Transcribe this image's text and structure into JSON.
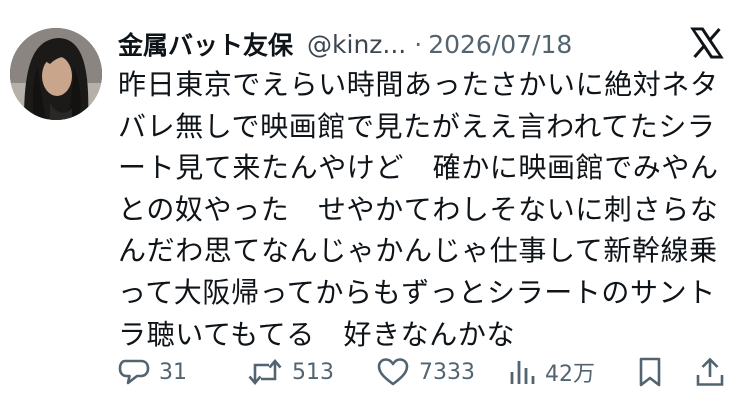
{
  "tweet": {
    "display_name": "金属バット友保",
    "handle": "@kinz...",
    "separator": "·",
    "date": "2026/07/18",
    "text_lines": [
      "昨日東京でえらい時間あったさかいに絶対ネタ",
      "バレ無しで映画館で見たがええ言われてたシラ",
      "ート見て来たんやけど　確かに映画館でみやん",
      "との奴やった　せやかてわしそないに刺さらな",
      "んだわ思てなんじゃかんじゃ仕事して新幹線乗",
      "って大阪帰ってからもずっとシラートのサント",
      "ラ聴いてもてる　好きなんかな"
    ]
  },
  "actions": {
    "replies": "31",
    "reposts": "513",
    "likes": "7333",
    "views": "42万"
  },
  "icons": {
    "brand": "x-logo-icon",
    "reply": "speech-bubble-icon",
    "repost": "repost-arrows-icon",
    "like": "heart-icon",
    "views": "bar-chart-icon",
    "bookmark": "bookmark-icon",
    "share": "share-upload-icon"
  },
  "colors": {
    "text": "#0f1419",
    "secondary": "#536471",
    "background": "#ffffff"
  }
}
